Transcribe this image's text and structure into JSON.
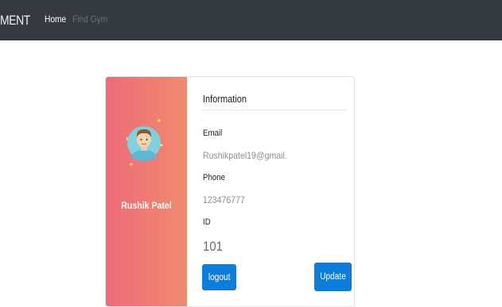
{
  "navbar": {
    "brand": "MENT",
    "home_label": "Home",
    "find_gym_label": "Find Gym"
  },
  "profile": {
    "name": "Rushik Patel",
    "avatar_icon": "user-avatar-icon"
  },
  "info": {
    "title": "Information",
    "email_label": "Email",
    "email_value": "Rushikpatel19@gmail.",
    "phone_label": "Phone",
    "phone_value": "123476777",
    "id_label": "ID",
    "id_value": "101"
  },
  "actions": {
    "logout_label": "logout",
    "update_label": "Update"
  },
  "colors": {
    "navbar_bg": "#343a40",
    "gradient_start": "#ee6b78",
    "gradient_end": "#f08a6e",
    "button_primary": "#0d7ddb"
  }
}
